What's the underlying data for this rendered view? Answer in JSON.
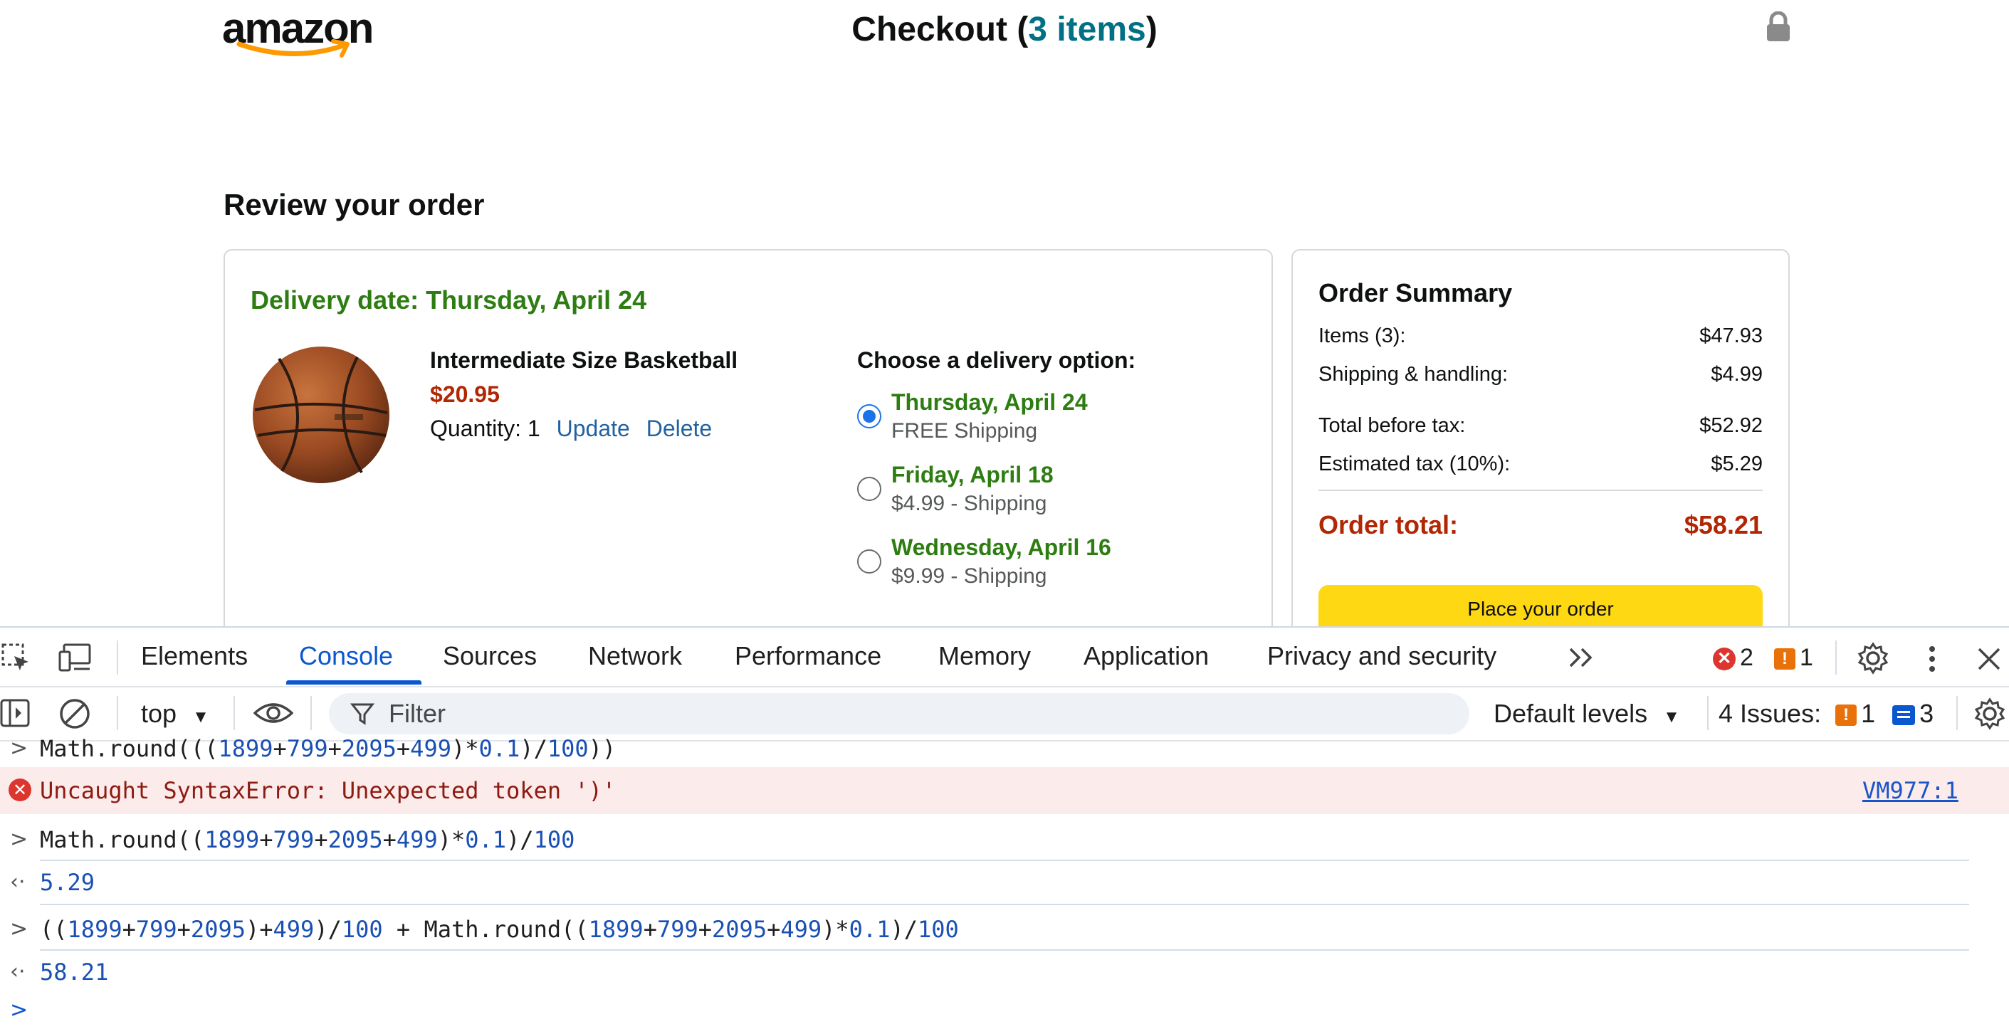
{
  "header": {
    "logo": "amazon",
    "title_prefix": "Checkout (",
    "title_count": "3 items",
    "title_suffix": ")"
  },
  "review": {
    "heading": "Review your order",
    "delivery_date": "Delivery date: Thursday, April 24",
    "product": {
      "name": "Intermediate Size Basketball",
      "price": "$20.95",
      "quantity_label": "Quantity: 1",
      "update_label": "Update",
      "delete_label": "Delete"
    },
    "choose_label": "Choose a delivery option:",
    "options": [
      {
        "date": "Thursday, April 24",
        "cost": "FREE Shipping",
        "selected": true
      },
      {
        "date": "Friday, April 18",
        "cost": "$4.99 - Shipping",
        "selected": false
      },
      {
        "date": "Wednesday, April 16",
        "cost": "$9.99 - Shipping",
        "selected": false
      }
    ]
  },
  "summary": {
    "title": "Order Summary",
    "items_label": "Items (3):",
    "items_value": "$47.93",
    "shipping_label": "Shipping & handling:",
    "shipping_value": "$4.99",
    "before_tax_label": "Total before tax:",
    "before_tax_value": "$52.92",
    "tax_label": "Estimated tax (10%):",
    "tax_value": "$5.29",
    "total_label": "Order total:",
    "total_value": "$58.21",
    "place_order": "Place your order"
  },
  "devtools": {
    "tabs": [
      "Elements",
      "Console",
      "Sources",
      "Network",
      "Performance",
      "Memory",
      "Application",
      "Privacy and security"
    ],
    "active_tab": "Console",
    "error_count": "2",
    "warning_count": "1",
    "context": "top",
    "filter_placeholder": "Filter",
    "levels": "Default levels",
    "issues_label": "4 Issues:",
    "issues_warn": "1",
    "issues_info": "3"
  },
  "console": {
    "line1": "Math.round(((1899+799+2095+499)*0.1)/100))",
    "error": "Uncaught SyntaxError: Unexpected token ')'",
    "error_source": "VM977:1",
    "line2": "Math.round((1899+799+2095+499)*0.1)/100",
    "result2": "5.29",
    "line3": "((1899+799+2095)+499)/100 + Math.round((1899+799+2095+499)*0.1)/100",
    "result3": "58.21"
  },
  "colors": {
    "green": "#2e7d12",
    "price_red": "#b12704",
    "link_blue": "#2162a1",
    "button_yellow": "#ffd814",
    "devtools_blue": "#0b57d0"
  }
}
